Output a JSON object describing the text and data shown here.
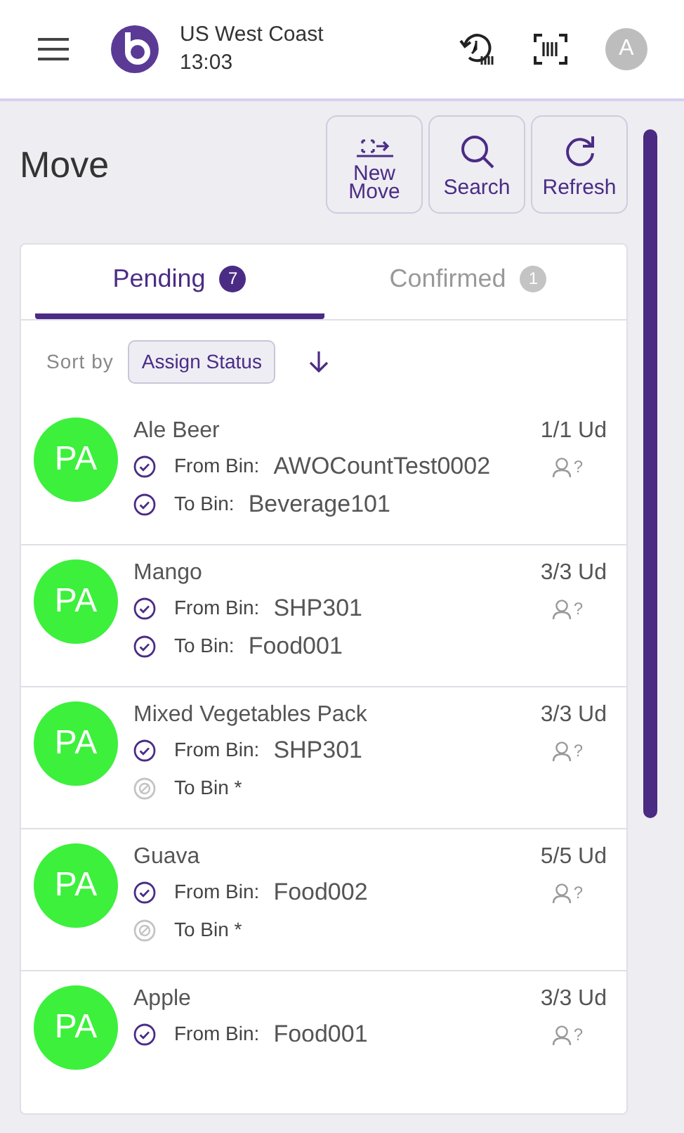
{
  "header": {
    "location": "US West Coast",
    "time": "13:03",
    "avatar": "A"
  },
  "page": {
    "title": "Move"
  },
  "actions": [
    {
      "kind": "new",
      "label_lines": [
        "New",
        "Move"
      ]
    },
    {
      "kind": "search",
      "label_lines": [
        "Search"
      ]
    },
    {
      "kind": "refresh",
      "label_lines": [
        "Refresh"
      ]
    }
  ],
  "tabs": [
    {
      "label": "Pending",
      "count": "7",
      "selected": true
    },
    {
      "label": "Confirmed",
      "count": "1",
      "selected": false
    }
  ],
  "sort": {
    "label": "Sort by",
    "value": "Assign Status"
  },
  "rows": [
    {
      "initials": "PA",
      "color": "#3cf03c",
      "name": "Ale Beer",
      "quantity": "1/1 Ud",
      "assignee": "?",
      "bins": [
        {
          "label": "From Bin:",
          "value": "AWOCountTest0002",
          "assigned": true
        },
        {
          "label": "To Bin:",
          "value": "Beverage101",
          "assigned": true
        }
      ]
    },
    {
      "initials": "PA",
      "color": "#3cf03c",
      "name": "Mango",
      "quantity": "3/3 Ud",
      "assignee": "?",
      "bins": [
        {
          "label": "From Bin:",
          "value": "SHP301",
          "assigned": true
        },
        {
          "label": "To Bin:",
          "value": "Food001",
          "assigned": true
        }
      ]
    },
    {
      "initials": "PA",
      "color": "#3cf03c",
      "name": "Mixed Vegetables Pack",
      "quantity": "3/3 Ud",
      "assignee": "?",
      "bins": [
        {
          "label": "From Bin:",
          "value": "SHP301",
          "assigned": true
        },
        {
          "label": "To Bin *",
          "assigned": false
        }
      ]
    },
    {
      "initials": "PA",
      "color": "#3cf03c",
      "name": "Guava",
      "quantity": "5/5 Ud",
      "assignee": "?",
      "bins": [
        {
          "label": "From Bin:",
          "value": "Food002",
          "assigned": true
        },
        {
          "label": "To Bin *",
          "assigned": false
        }
      ]
    },
    {
      "initials": "PA",
      "color": "#3cf03c",
      "name": "Apple",
      "quantity": "3/3 Ud",
      "assignee": "?",
      "bins": [
        {
          "label": "From Bin:",
          "value": "Food001",
          "assigned": true
        }
      ]
    }
  ]
}
